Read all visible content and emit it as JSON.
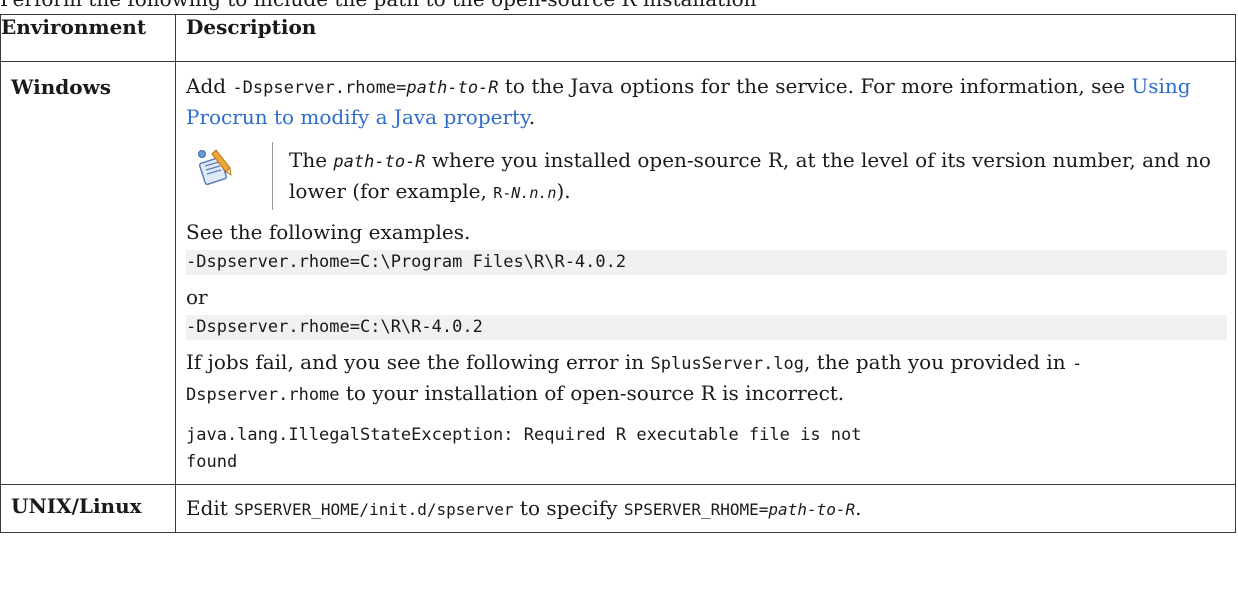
{
  "intro": "Perform the following to include the path to the open-source R installation",
  "table": {
    "headers": [
      "Environment",
      "Description"
    ],
    "windows": {
      "env": "Windows",
      "p1_text1": "Add ",
      "p1_code1": "-Dspserver.rhome=",
      "p1_code1_italic": "path-to-R",
      "p1_text2": " to the Java options for the service. For more information, see ",
      "p1_link": "Using Procrun to modify a Java property",
      "p1_text3": ".",
      "note_text1": "The ",
      "note_code1": "path-to-R",
      "note_text2": " where you installed open-source R, at the level of its version number, and no lower (for example, ",
      "note_code2": "R-",
      "note_code2_italic": "N.n.n",
      "note_text3": ").",
      "see_examples": "See the following examples.",
      "example1": "-Dspserver.rhome=C:\\Program Files\\R\\R-4.0.2",
      "or": "or",
      "example2": "-Dspserver.rhome=C:\\R\\R-4.0.2",
      "p3_text1": "If jobs fail, and you see the following error in ",
      "p3_code1": "SplusServer.log",
      "p3_text2": ", the path you provided in ",
      "p3_code2": "-Dspserver.rhome",
      "p3_text3": " to your installation of open-source R is incorrect.",
      "error_line1": "java.lang.IllegalStateException: Required R executable file is not",
      "error_line2": "found"
    },
    "unix": {
      "env": "UNIX/Linux",
      "text1": "Edit ",
      "code1": "SPSERVER_HOME/init.d/spserver",
      "text2": " to specify ",
      "code2": "SPSERVER_RHOME=",
      "code2_italic": "path-to-R",
      "text3": "."
    }
  },
  "icons": {
    "note": "note-pencil-icon"
  },
  "colors": {
    "link": "#2e6ccc",
    "code_bg": "#f1f1f1",
    "border": "#3a3a3a"
  }
}
